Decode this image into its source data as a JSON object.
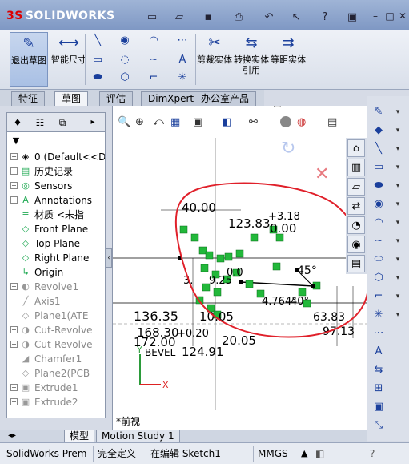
{
  "app": {
    "brand": "SOLIDWORKS",
    "brand_prefix": "3S"
  },
  "quick_access": [
    {
      "name": "new-icon",
      "glyph": "🗋"
    },
    {
      "name": "open-icon",
      "glyph": "📂"
    },
    {
      "name": "save-icon",
      "glyph": "💾"
    },
    {
      "name": "print-icon",
      "glyph": "🖶"
    },
    {
      "name": "undo-icon",
      "glyph": "↶"
    },
    {
      "name": "select-icon",
      "glyph": "↖"
    },
    {
      "name": "help-icon",
      "glyph": "?"
    },
    {
      "name": "options-icon",
      "glyph": "▣"
    }
  ],
  "window_controls": [
    "–",
    "□",
    "✕"
  ],
  "ribbon": {
    "exit_sketch": {
      "label": "退出草图",
      "icon": "exit-sketch-icon"
    },
    "smart_dimension": {
      "label": "智能尺寸",
      "icon": "smart-dimension-icon"
    },
    "trim": {
      "label": "剪裁实体",
      "icon": "trim-icon"
    },
    "convert": {
      "label": "转换实体引用",
      "icon": "convert-entities-icon"
    },
    "offset": {
      "label": "等距实体",
      "icon": "offset-entities-icon"
    }
  },
  "command_tabs": [
    "特征",
    "草图",
    "评估",
    "DimXpert",
    "办公室产品"
  ],
  "selected_tab": "草图",
  "tree": {
    "root": "0  (Default<<D",
    "items": [
      {
        "label": "历史记录",
        "icon": "history-icon",
        "dim": false,
        "expand": "+"
      },
      {
        "label": "Sensors",
        "icon": "sensor-icon",
        "dim": false,
        "expand": "+"
      },
      {
        "label": "Annotations",
        "icon": "annotations-icon",
        "dim": false,
        "expand": "+"
      },
      {
        "label": "材质 <未指",
        "icon": "material-icon",
        "dim": false,
        "expand": ""
      },
      {
        "label": "Front Plane",
        "icon": "plane-icon",
        "dim": false,
        "expand": ""
      },
      {
        "label": "Top Plane",
        "icon": "plane-icon",
        "dim": false,
        "expand": ""
      },
      {
        "label": "Right Plane",
        "icon": "plane-icon",
        "dim": false,
        "expand": ""
      },
      {
        "label": "Origin",
        "icon": "origin-icon",
        "dim": false,
        "expand": ""
      },
      {
        "label": "Revolve1",
        "icon": "revolve-icon",
        "dim": true,
        "expand": "+"
      },
      {
        "label": "Axis1",
        "icon": "axis-icon",
        "dim": true,
        "expand": ""
      },
      {
        "label": "Plane1(ATE",
        "icon": "plane-icon",
        "dim": true,
        "expand": ""
      },
      {
        "label": "Cut-Revolve",
        "icon": "cut-revolve-icon",
        "dim": true,
        "expand": "+"
      },
      {
        "label": "Cut-Revolve",
        "icon": "cut-revolve-icon",
        "dim": true,
        "expand": "+"
      },
      {
        "label": "Chamfer1",
        "icon": "chamfer-icon",
        "dim": true,
        "expand": ""
      },
      {
        "label": "Plane2(PCB",
        "icon": "plane-icon",
        "dim": true,
        "expand": ""
      },
      {
        "label": "Extrude1",
        "icon": "extrude-icon",
        "dim": true,
        "expand": "+"
      },
      {
        "label": "Extrude2",
        "icon": "extrude-icon",
        "dim": true,
        "expand": "+"
      }
    ]
  },
  "drawing": {
    "dims": [
      "40.00",
      "123.83",
      "+3.18",
      "0.00",
      "45°",
      "4.764°",
      "40°",
      "136.35",
      "10.05",
      "168.30",
      "+0.20",
      "172.00",
      "BEVEL",
      "124.91",
      "20.05",
      "63.83",
      "97.13",
      "0.0",
      "9.25",
      "3."
    ],
    "view_label": "*前视",
    "axis_y": "Y",
    "axis_x": "X"
  },
  "bottom_tabs": [
    "模型",
    "Motion Study 1"
  ],
  "status": {
    "app": "SolidWorks Prem",
    "defined": "完全定义",
    "editing": "在编辑 Sketch1",
    "units": "MMGS"
  },
  "colors": {
    "annotation_red": "#e0202a",
    "relation_green": "#22b83a",
    "brand_red": "#cc1111"
  }
}
